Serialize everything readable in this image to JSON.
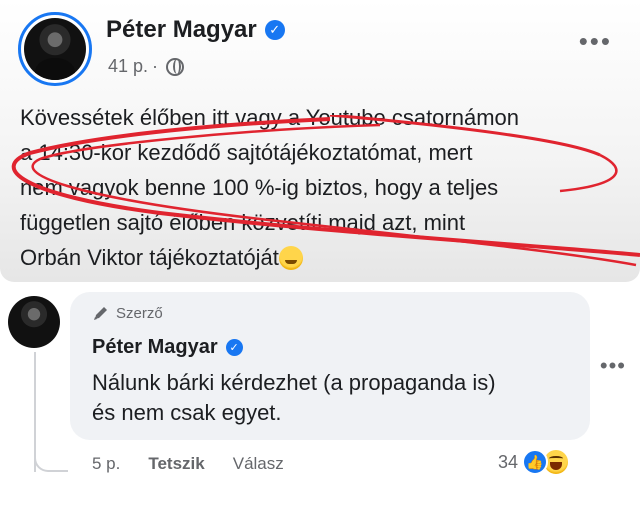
{
  "post": {
    "author": "Péter Magyar",
    "time": "41 p.",
    "separator": "·",
    "text_lines": [
      "Kövessétek élőben itt vagy a Youtube csatornámon",
      "a 14:30-kor kezdődő sajtótájékoztatómat, mert",
      "nem vagyok benne 100 %-ig biztos, hogy a teljes",
      "független sajtó élőben közvetíti majd azt, mint",
      "Orbán Viktor tájékoztatóját"
    ],
    "more_icon": "more-horizontal-icon",
    "audience_icon": "globe-icon",
    "emoji": "wink-tongue-emoji"
  },
  "annotation": {
    "color": "#e0242f",
    "type": "red-scribble"
  },
  "comment": {
    "badge": "Szerző",
    "author": "Péter Magyar",
    "text_line1": "Nálunk bárki kérdezhet (a propaganda is)",
    "text_line2": "és nem csak egyet.",
    "time": "5 p.",
    "like_label": "Tetszik",
    "reply_label": "Válasz",
    "reaction_count": "34",
    "reactions": [
      "like",
      "haha"
    ]
  },
  "colors": {
    "accent": "#1877f2",
    "muted": "#65676b",
    "bubble": "#f0f2f5"
  }
}
